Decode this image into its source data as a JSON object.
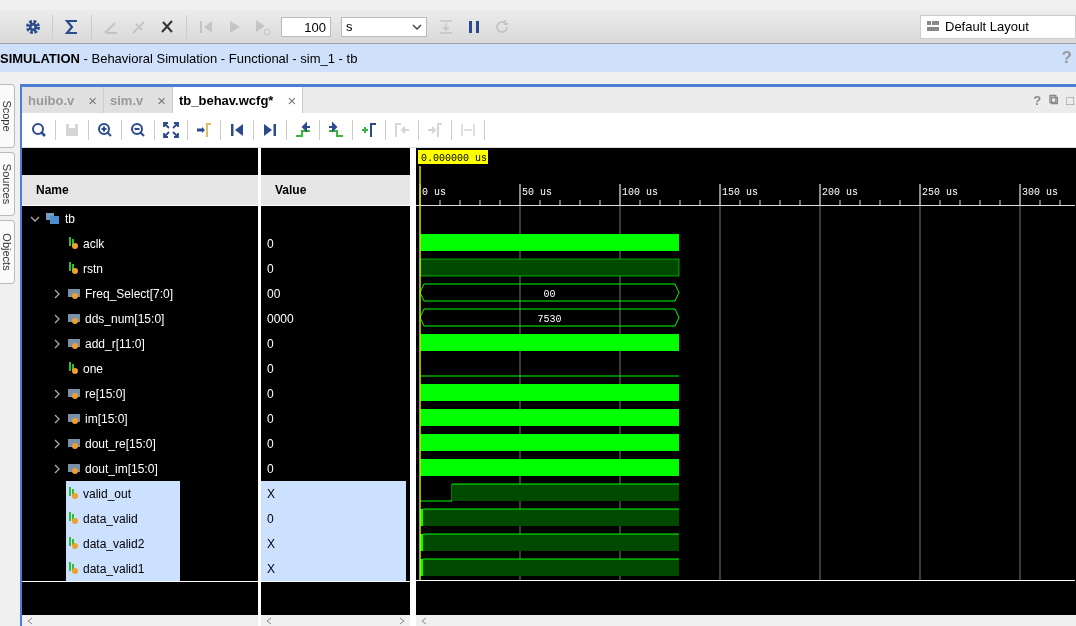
{
  "toolbar": {
    "run_time": "100",
    "time_unit": "s",
    "layout": "Default Layout"
  },
  "banner": {
    "title": "SIMULATION",
    "subtitle": " - Behavioral Simulation - Functional - sim_1 - tb",
    "help": "?"
  },
  "side_tabs": [
    "Scope",
    "Sources",
    "Objects"
  ],
  "tabs": [
    {
      "label": "huibo.v",
      "selected": false,
      "close": "×"
    },
    {
      "label": "sim.v",
      "selected": false,
      "close": "×"
    },
    {
      "label": "tb_behav.wcfg*",
      "selected": true,
      "close": "×"
    }
  ],
  "panel_buttons": [
    "?",
    "⧉",
    "□"
  ],
  "columns": {
    "name": "Name",
    "value": "Value"
  },
  "cursor_time": "0.000000 us",
  "ruler": [
    "0 us",
    "50 us",
    "100 us",
    "150 us",
    "200 us",
    "250 us",
    "300 us"
  ],
  "tree": {
    "label": "tb",
    "expanded": true,
    "children": [
      {
        "name": "aclk",
        "kind": "bit",
        "value": "0",
        "selected": false,
        "wave": {
          "kind": "dense"
        }
      },
      {
        "name": "rstn",
        "kind": "bit",
        "value": "0",
        "selected": false,
        "wave": {
          "kind": "dark"
        }
      },
      {
        "name": "Freq_Select[7:0]",
        "kind": "bus",
        "expanded": false,
        "value": "00",
        "selected": false,
        "wave": {
          "kind": "bus",
          "label": "00"
        }
      },
      {
        "name": "dds_num[15:0]",
        "kind": "bus",
        "expanded": false,
        "value": "0000",
        "selected": false,
        "wave": {
          "kind": "bus",
          "label": "7530"
        }
      },
      {
        "name": "add_r[11:0]",
        "kind": "bus",
        "expanded": false,
        "value": "0",
        "selected": false,
        "wave": {
          "kind": "dense"
        }
      },
      {
        "name": "one",
        "kind": "bit",
        "value": "0",
        "selected": false,
        "wave": {
          "kind": "low"
        }
      },
      {
        "name": "re[15:0]",
        "kind": "bus",
        "expanded": false,
        "value": "0",
        "selected": false,
        "wave": {
          "kind": "dense"
        }
      },
      {
        "name": "im[15:0]",
        "kind": "bus",
        "expanded": false,
        "value": "0",
        "selected": false,
        "wave": {
          "kind": "dense"
        }
      },
      {
        "name": "dout_re[15:0]",
        "kind": "bus",
        "expanded": false,
        "value": "0",
        "selected": false,
        "wave": {
          "kind": "dense"
        }
      },
      {
        "name": "dout_im[15:0]",
        "kind": "bus",
        "expanded": false,
        "value": "0",
        "selected": false,
        "wave": {
          "kind": "dense"
        }
      },
      {
        "name": "valid_out",
        "kind": "bit",
        "value": "X",
        "selected": true,
        "wave": {
          "kind": "rise"
        }
      },
      {
        "name": "data_valid",
        "kind": "bit",
        "value": "0",
        "selected": true,
        "wave": {
          "kind": "high"
        }
      },
      {
        "name": "data_valid2",
        "kind": "bit",
        "value": "X",
        "selected": true,
        "wave": {
          "kind": "high"
        }
      },
      {
        "name": "data_valid1",
        "kind": "bit",
        "value": "X",
        "selected": true,
        "wave": {
          "kind": "high"
        }
      }
    ]
  }
}
